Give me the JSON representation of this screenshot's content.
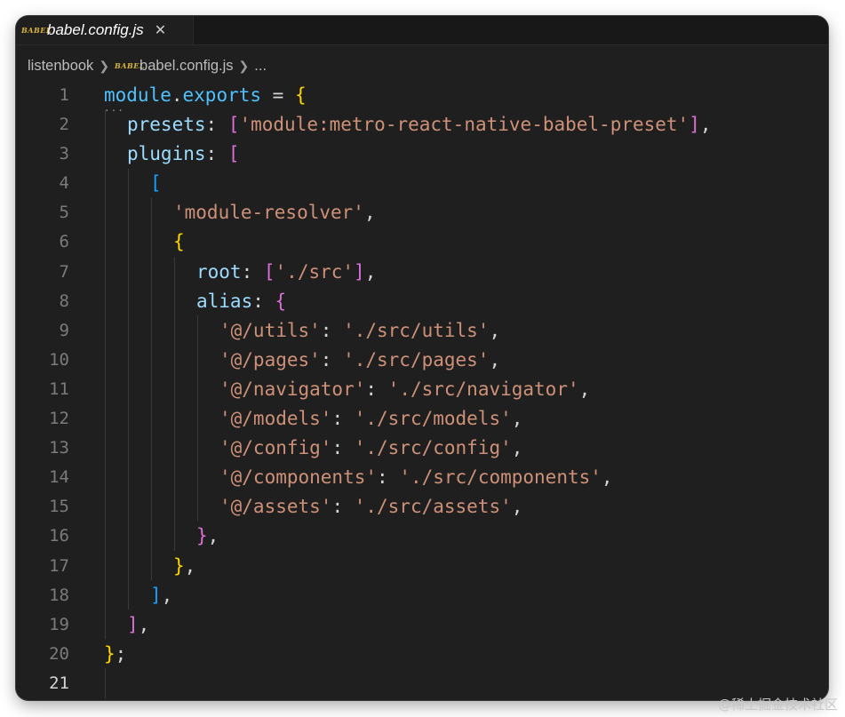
{
  "tab": {
    "icon": "babel-file-icon",
    "icon_text": "BABEL",
    "title": "babel.config.js",
    "close_glyph": "✕"
  },
  "breadcrumb": {
    "folder": "listenbook",
    "file": "babel.config.js",
    "more": "..."
  },
  "editor": {
    "active_line": 21,
    "lines": [
      {
        "n": "1",
        "indent": 0,
        "tokens": [
          [
            "t-var",
            "module"
          ],
          [
            "t-punc",
            "."
          ],
          [
            "t-var",
            "exports"
          ],
          [
            "t-punc",
            " = "
          ],
          [
            "t-b1",
            "{"
          ]
        ]
      },
      {
        "n": "2",
        "indent": 1,
        "tokens": [
          [
            "t-prop",
            "presets"
          ],
          [
            "t-punc",
            ": "
          ],
          [
            "t-b2",
            "["
          ],
          [
            "t-str",
            "'module:metro-react-native-babel-preset'"
          ],
          [
            "t-b2",
            "]"
          ],
          [
            "t-punc",
            ","
          ]
        ]
      },
      {
        "n": "3",
        "indent": 1,
        "tokens": [
          [
            "t-prop",
            "plugins"
          ],
          [
            "t-punc",
            ": "
          ],
          [
            "t-b2",
            "["
          ]
        ]
      },
      {
        "n": "4",
        "indent": 2,
        "tokens": [
          [
            "t-b3",
            "["
          ]
        ]
      },
      {
        "n": "5",
        "indent": 3,
        "tokens": [
          [
            "t-str",
            "'module-resolver'"
          ],
          [
            "t-punc",
            ","
          ]
        ]
      },
      {
        "n": "6",
        "indent": 3,
        "tokens": [
          [
            "t-b1",
            "{"
          ]
        ]
      },
      {
        "n": "7",
        "indent": 4,
        "tokens": [
          [
            "t-prop",
            "root"
          ],
          [
            "t-punc",
            ": "
          ],
          [
            "t-b2",
            "["
          ],
          [
            "t-str",
            "'./src'"
          ],
          [
            "t-b2",
            "]"
          ],
          [
            "t-punc",
            ","
          ]
        ]
      },
      {
        "n": "8",
        "indent": 4,
        "tokens": [
          [
            "t-prop",
            "alias"
          ],
          [
            "t-punc",
            ": "
          ],
          [
            "t-b2",
            "{"
          ]
        ]
      },
      {
        "n": "9",
        "indent": 5,
        "tokens": [
          [
            "t-str",
            "'@/utils'"
          ],
          [
            "t-punc",
            ": "
          ],
          [
            "t-str",
            "'./src/utils'"
          ],
          [
            "t-punc",
            ","
          ]
        ]
      },
      {
        "n": "10",
        "indent": 5,
        "tokens": [
          [
            "t-str",
            "'@/pages'"
          ],
          [
            "t-punc",
            ": "
          ],
          [
            "t-str",
            "'./src/pages'"
          ],
          [
            "t-punc",
            ","
          ]
        ]
      },
      {
        "n": "11",
        "indent": 5,
        "tokens": [
          [
            "t-str",
            "'@/navigator'"
          ],
          [
            "t-punc",
            ": "
          ],
          [
            "t-str",
            "'./src/navigator'"
          ],
          [
            "t-punc",
            ","
          ]
        ]
      },
      {
        "n": "12",
        "indent": 5,
        "tokens": [
          [
            "t-str",
            "'@/models'"
          ],
          [
            "t-punc",
            ": "
          ],
          [
            "t-str",
            "'./src/models'"
          ],
          [
            "t-punc",
            ","
          ]
        ]
      },
      {
        "n": "13",
        "indent": 5,
        "tokens": [
          [
            "t-str",
            "'@/config'"
          ],
          [
            "t-punc",
            ": "
          ],
          [
            "t-str",
            "'./src/config'"
          ],
          [
            "t-punc",
            ","
          ]
        ]
      },
      {
        "n": "14",
        "indent": 5,
        "tokens": [
          [
            "t-str",
            "'@/components'"
          ],
          [
            "t-punc",
            ": "
          ],
          [
            "t-str",
            "'./src/components'"
          ],
          [
            "t-punc",
            ","
          ]
        ]
      },
      {
        "n": "15",
        "indent": 5,
        "tokens": [
          [
            "t-str",
            "'@/assets'"
          ],
          [
            "t-punc",
            ": "
          ],
          [
            "t-str",
            "'./src/assets'"
          ],
          [
            "t-punc",
            ","
          ]
        ]
      },
      {
        "n": "16",
        "indent": 4,
        "tokens": [
          [
            "t-b2",
            "}"
          ],
          [
            "t-punc",
            ","
          ]
        ]
      },
      {
        "n": "17",
        "indent": 3,
        "tokens": [
          [
            "t-b1",
            "}"
          ],
          [
            "t-punc",
            ","
          ]
        ]
      },
      {
        "n": "18",
        "indent": 2,
        "tokens": [
          [
            "t-b3",
            "]"
          ],
          [
            "t-punc",
            ","
          ]
        ]
      },
      {
        "n": "19",
        "indent": 1,
        "tokens": [
          [
            "t-b2",
            "]"
          ],
          [
            "t-punc",
            ","
          ]
        ]
      },
      {
        "n": "20",
        "indent": 0,
        "tokens": [
          [
            "t-b1",
            "}"
          ],
          [
            "t-punc",
            ";"
          ]
        ]
      },
      {
        "n": "21",
        "indent": 0,
        "tokens": []
      }
    ]
  },
  "watermark": "@稀土掘金技术社区"
}
